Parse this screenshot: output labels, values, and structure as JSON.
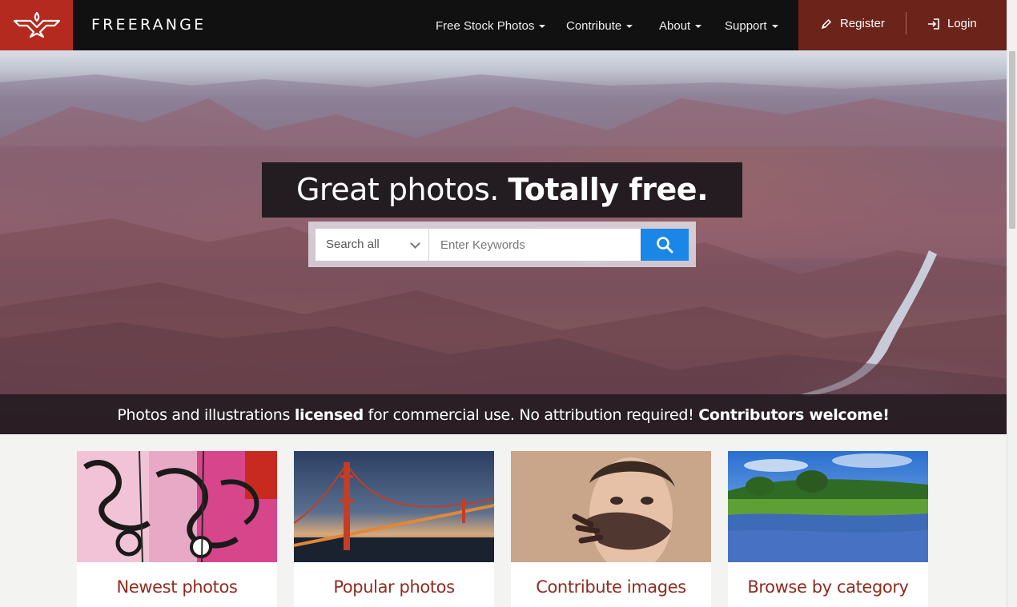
{
  "brand": {
    "name": "FREERANGE",
    "logo_color": "#b42a1f"
  },
  "nav": {
    "items": [
      {
        "label": "Free Stock Photos"
      },
      {
        "label": "Contribute"
      },
      {
        "label": "About"
      },
      {
        "label": "Support"
      }
    ]
  },
  "account": {
    "register_label": "Register",
    "login_label": "Login",
    "bg_color": "#6b231a"
  },
  "hero": {
    "headline_light": "Great photos. ",
    "headline_bold": "Totally free.",
    "search": {
      "select_value": "Search all",
      "placeholder": "Enter Keywords",
      "button_color": "#1a87e8"
    },
    "tagline": {
      "part1": "Photos and illustrations ",
      "part2_bold": "licensed",
      "part3": " for commercial use. No attribution required! ",
      "part4_bold": "Contributors welcome!"
    }
  },
  "cards": [
    {
      "title": "Newest photos"
    },
    {
      "title": "Popular photos"
    },
    {
      "title": "Contribute images"
    },
    {
      "title": "Browse by category"
    }
  ],
  "colors": {
    "accent_red": "#8f2b1f",
    "header_bg": "#111111"
  }
}
